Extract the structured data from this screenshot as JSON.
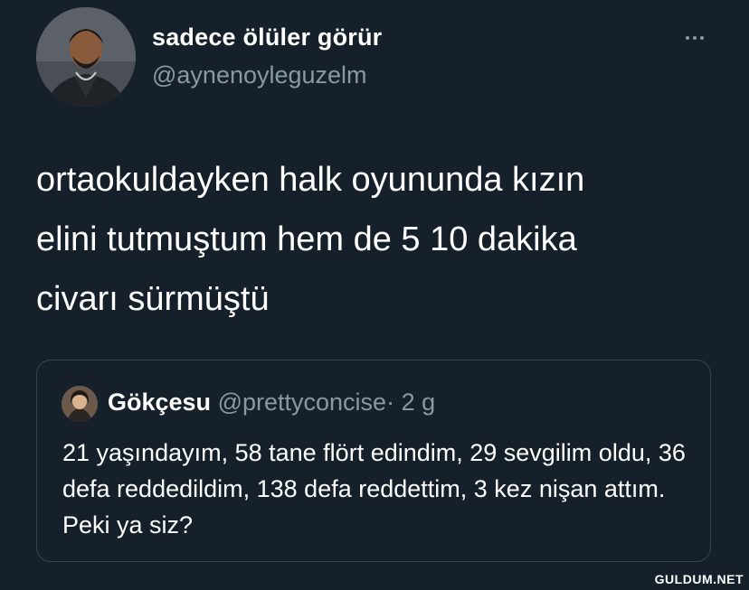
{
  "author": {
    "display_name": "sadece ölüler görür",
    "handle": "@aynenoyleguzelm"
  },
  "tweet": {
    "text": "ortaokuldayken halk oyununda kızın\nelini tutmuştum hem de 5 10 dakika\ncivarı sürmüştü"
  },
  "quoted_tweet": {
    "display_name": "Gökçesu",
    "handle": "@prettyconcise",
    "separator": "·",
    "time": "2 g",
    "text": "21 yaşındayım, 58 tane flört edindim, 29 sevgilim oldu, 36 defa reddedildim, 138 defa reddettim, 3 kez nişan attım. Peki ya siz?"
  },
  "icons": {
    "more": "more-horizontal-icon"
  },
  "watermark": "GULDUM.NET",
  "colors": {
    "background": "#15202b",
    "text_primary": "#ffffff",
    "text_secondary": "#8899a6",
    "border": "#38444d"
  }
}
